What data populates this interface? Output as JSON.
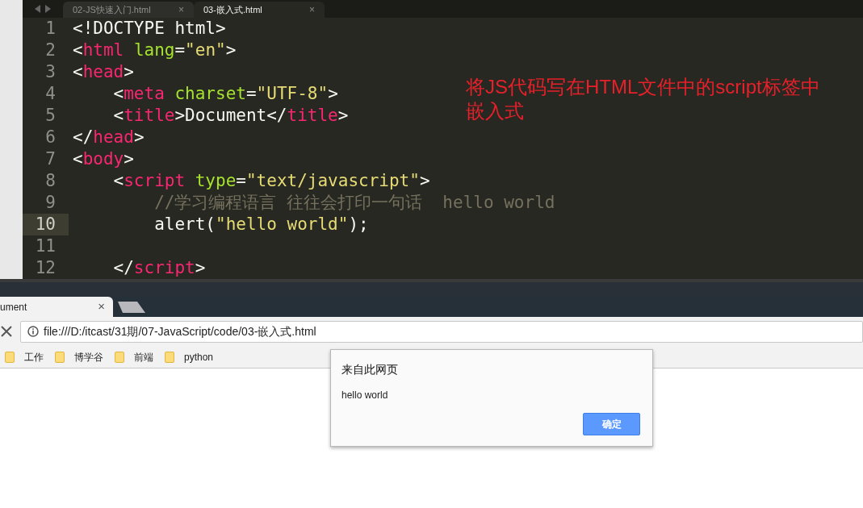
{
  "editor": {
    "tabs": [
      {
        "label": "02-JS快速入门.html",
        "close": "×",
        "selected": false
      },
      {
        "label": "03-嵌入式.html",
        "close": "×",
        "selected": true
      }
    ],
    "lines": [
      {
        "number": "1",
        "current": false,
        "tokens": [
          {
            "kind": "text",
            "text": "<!DOCTYPE html>"
          }
        ]
      },
      {
        "number": "2",
        "current": false,
        "tokens": [
          {
            "kind": "text",
            "text": "<"
          },
          {
            "kind": "tag",
            "text": "html"
          },
          {
            "kind": "attr",
            "text": " lang"
          },
          {
            "kind": "text",
            "text": "="
          },
          {
            "kind": "string",
            "text": "\"en\""
          },
          {
            "kind": "text",
            "text": ">"
          }
        ]
      },
      {
        "number": "3",
        "current": false,
        "tokens": [
          {
            "kind": "text",
            "text": "<"
          },
          {
            "kind": "tag",
            "text": "head"
          },
          {
            "kind": "text",
            "text": ">"
          }
        ]
      },
      {
        "number": "4",
        "current": false,
        "tokens": [
          {
            "kind": "text",
            "text": "    <"
          },
          {
            "kind": "tag",
            "text": "meta"
          },
          {
            "kind": "attr",
            "text": " charset"
          },
          {
            "kind": "text",
            "text": "="
          },
          {
            "kind": "string",
            "text": "\"UTF-8\""
          },
          {
            "kind": "text",
            "text": ">"
          }
        ]
      },
      {
        "number": "5",
        "current": false,
        "tokens": [
          {
            "kind": "text",
            "text": "    <"
          },
          {
            "kind": "tag",
            "text": "title"
          },
          {
            "kind": "text",
            "text": ">Document</"
          },
          {
            "kind": "tag",
            "text": "title"
          },
          {
            "kind": "text",
            "text": ">"
          }
        ]
      },
      {
        "number": "6",
        "current": false,
        "tokens": [
          {
            "kind": "text",
            "text": "</"
          },
          {
            "kind": "tag",
            "text": "head"
          },
          {
            "kind": "text",
            "text": ">"
          }
        ]
      },
      {
        "number": "7",
        "current": false,
        "tokens": [
          {
            "kind": "text",
            "text": "<"
          },
          {
            "kind": "tag",
            "text": "body"
          },
          {
            "kind": "text",
            "text": ">"
          }
        ]
      },
      {
        "number": "8",
        "current": false,
        "tokens": [
          {
            "kind": "text",
            "text": "    <"
          },
          {
            "kind": "tag",
            "text": "script"
          },
          {
            "kind": "attr",
            "text": " type"
          },
          {
            "kind": "text",
            "text": "="
          },
          {
            "kind": "string",
            "text": "\"text/javascript\""
          },
          {
            "kind": "text",
            "text": ">"
          }
        ]
      },
      {
        "number": "9",
        "current": false,
        "tokens": [
          {
            "kind": "comment",
            "text": "        //学习编程语言 往往会打印一句话  hello world"
          }
        ]
      },
      {
        "number": "10",
        "current": true,
        "tokens": [
          {
            "kind": "text",
            "text": "        alert("
          },
          {
            "kind": "string",
            "text": "\"hello world\""
          },
          {
            "kind": "text",
            "text": ");"
          }
        ]
      },
      {
        "number": "11",
        "current": false
      },
      {
        "number": "12",
        "current": false,
        "tokens": [
          {
            "kind": "text",
            "text": "    </"
          },
          {
            "kind": "tag",
            "text": "script"
          },
          {
            "kind": "text",
            "text": ">"
          }
        ]
      }
    ],
    "annotation": [
      "将JS代码写在HTML文件中的script标签中",
      "嵌入式"
    ]
  },
  "browser": {
    "tab": {
      "title": "ument",
      "close": "×"
    },
    "address": "file:///D:/itcast/31期/07-JavaScript/code/03-嵌入式.html",
    "bookmarks": [
      "工作",
      "博学谷",
      "前端",
      "python"
    ],
    "dialog": {
      "title": "来自此网页",
      "message": "hello world",
      "button": "确定"
    }
  }
}
